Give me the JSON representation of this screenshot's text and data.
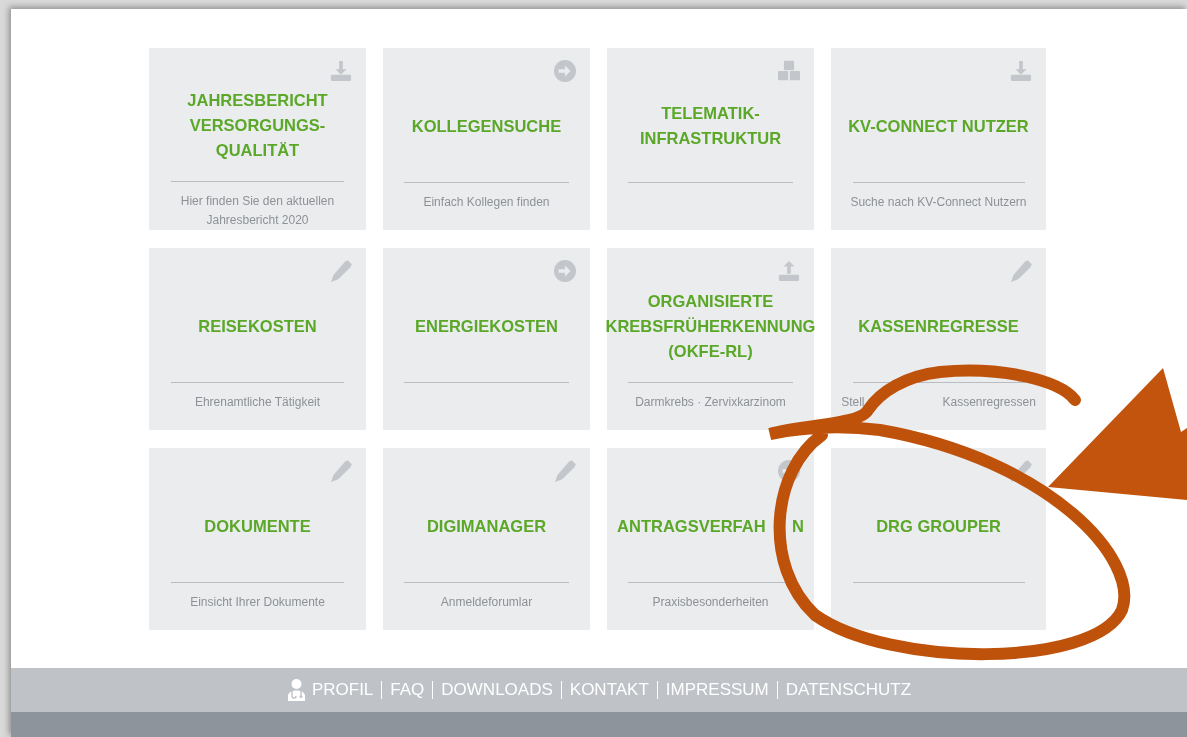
{
  "tiles": [
    {
      "kind": "download",
      "title_lines": [
        [
          "JAHRESBERICHT"
        ],
        [
          "VERSORGUNGS-"
        ],
        [
          "QUALITÄT"
        ]
      ],
      "subtitle_lines": [
        [
          "Hier finden Sie den aktuellen"
        ],
        [
          "Jahresbericht 2020"
        ]
      ]
    },
    {
      "kind": "arrow",
      "title_lines": [
        [
          "KOLLEGENSUCHE"
        ]
      ],
      "subtitle_lines": [
        [
          "Einfach Kollegen finden"
        ]
      ]
    },
    {
      "kind": "cubes",
      "title_lines": [
        [
          "TELEMATIK-"
        ],
        [
          "INFRASTRUKTUR"
        ]
      ]
    },
    {
      "kind": "download",
      "title_lines": [
        [
          "KV-CONNECT NUTZER"
        ]
      ],
      "subtitle_lines": [
        [
          "Suche nach KV-Connect Nutzern"
        ]
      ]
    },
    {
      "kind": "pencil",
      "title_lines": [
        [
          "REISEKOSTEN"
        ]
      ],
      "subtitle_lines": [
        [
          "Ehrenamtliche Tätigkeit"
        ]
      ]
    },
    {
      "kind": "arrow",
      "title_lines": [
        [
          "ENERGIEKOSTEN"
        ]
      ]
    },
    {
      "kind": "upload",
      "title_lines": [
        [
          "ORGANISIERTE"
        ],
        [
          "KREBSFRÜHERKENNUNG"
        ],
        [
          "(OKFE-RL)"
        ]
      ],
      "subtitle_lines": [
        [
          "Darmkrebs · Zervixkarzinom"
        ]
      ]
    },
    {
      "kind": "pencil",
      "title_lines": [
        [
          "KASSENREGRESSE"
        ]
      ],
      "subtitle_lines": [
        [
          "Stell",
          "Kassenregressen"
        ]
      ]
    },
    {
      "kind": "pencil",
      "title_lines": [
        [
          "DOKUMENTE"
        ]
      ],
      "subtitle_lines": [
        [
          "Einsicht Ihrer Dokumente"
        ]
      ]
    },
    {
      "kind": "pencil",
      "title_lines": [
        [
          "DIGIMANAGER"
        ]
      ],
      "subtitle_lines": [
        [
          "Anmeldeforumlar"
        ]
      ]
    },
    {
      "kind": "arrow",
      "title_lines": [
        [
          "ANTRAGSVERFAH",
          "N"
        ]
      ],
      "subtitle_lines": [
        [
          "Praxisbesonderheiten"
        ]
      ]
    },
    {
      "kind": "pencil",
      "title_lines": [
        [
          "DRG GROUPER"
        ]
      ]
    }
  ],
  "footer": {
    "links": [
      {
        "label": "PROFIL",
        "kind": "profile"
      },
      {
        "label": "FAQ"
      },
      {
        "label": "DOWNLOADS"
      },
      {
        "label": "KONTAKT"
      },
      {
        "label": "IMPRESSUM"
      },
      {
        "label": "DATENSCHUTZ"
      }
    ]
  }
}
